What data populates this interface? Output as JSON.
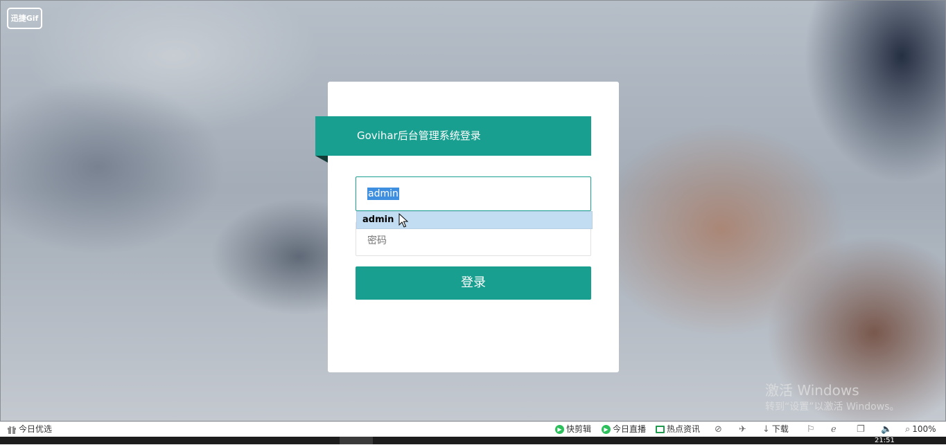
{
  "overlay": {
    "recorder_logo": "迅捷Gif"
  },
  "login": {
    "title": "Govihar后台管理系统登录",
    "username_value": "admin",
    "autocomplete_suggestion": "admin",
    "password_placeholder": "密码",
    "submit_label": "登录"
  },
  "watermark": {
    "line1": "激活 Windows",
    "line2": "转到“设置”以激活 Windows。"
  },
  "statusbar": {
    "left_label": "今日优选",
    "items": [
      "快剪辑",
      "今日直播",
      "热点资讯",
      "下载"
    ],
    "zoom": "100%"
  },
  "taskbar": {
    "clock": "21:51"
  },
  "colors": {
    "accent": "#199f8f",
    "selection": "#3f8fe0",
    "suggestion_bg": "#c2dcf2"
  }
}
